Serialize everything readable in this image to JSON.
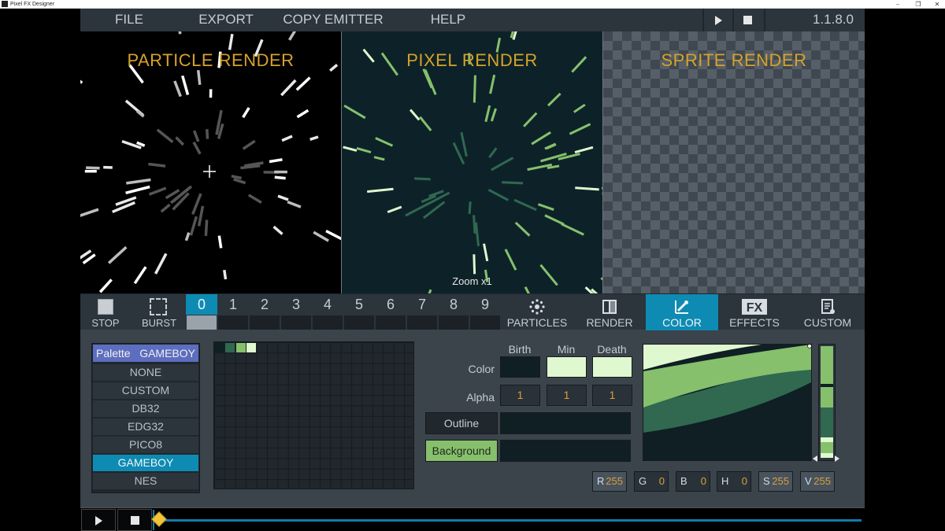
{
  "window": {
    "title": "Pixel FX Designer",
    "controls": [
      "–",
      "❐",
      "✕"
    ]
  },
  "menu": {
    "file": "FILE",
    "export": "EXPORT",
    "copy_emitter": "COPY EMITTER",
    "help": "HELP",
    "version": "1.1.8.0"
  },
  "panels": {
    "particle_title": "PARTICLE RENDER",
    "pixel_title": "PIXEL RENDER",
    "sprite_title": "SPRITE RENDER",
    "zoom_label": "Zoom x1"
  },
  "controls": {
    "stop": "STOP",
    "burst": "BURST"
  },
  "emitters": {
    "slots": [
      "0",
      "1",
      "2",
      "3",
      "4",
      "5",
      "6",
      "7",
      "8",
      "9"
    ],
    "active": 0
  },
  "tabs": {
    "particles": "PARTICLES",
    "render": "RENDER",
    "color": "COLOR",
    "effects": "EFFECTS",
    "custom": "CUSTOM",
    "active": "color"
  },
  "palette": {
    "header_label": "Palette",
    "header_value": "GAMEBOY",
    "options": [
      "NONE",
      "CUSTOM",
      "DB32",
      "EDG32",
      "PICO8",
      "GAMEBOY",
      "NES"
    ],
    "selected": "GAMEBOY",
    "swatches": [
      "#0f1f24",
      "#306850",
      "#86c06c",
      "#e0f8cf"
    ]
  },
  "color_editor": {
    "col_birth": "Birth",
    "col_min": "Min",
    "col_death": "Death",
    "row_color": "Color",
    "row_alpha": "Alpha",
    "color_birth": "#0f1f24",
    "color_min": "#e0f8cf",
    "color_death": "#e0f8cf",
    "alpha_birth": "1",
    "alpha_min": "1",
    "alpha_death": "1",
    "outline_label": "Outline",
    "background_label": "Background",
    "outline_color": "#0f1f24",
    "background_color": "#0f1f24"
  },
  "channels": [
    {
      "key": "R",
      "value": "255"
    },
    {
      "key": "G",
      "value": "0"
    },
    {
      "key": "B",
      "value": "0"
    },
    {
      "key": "H",
      "value": "0"
    },
    {
      "key": "S",
      "value": "255"
    },
    {
      "key": "V",
      "value": "255"
    }
  ],
  "colors": {
    "accent": "#0e8bb3",
    "title_gold": "#d6a22a",
    "gb_dark": "#0f1f24",
    "gb_mid_dark": "#306850",
    "gb_mid_light": "#86c06c",
    "gb_light": "#e0f8cf"
  }
}
